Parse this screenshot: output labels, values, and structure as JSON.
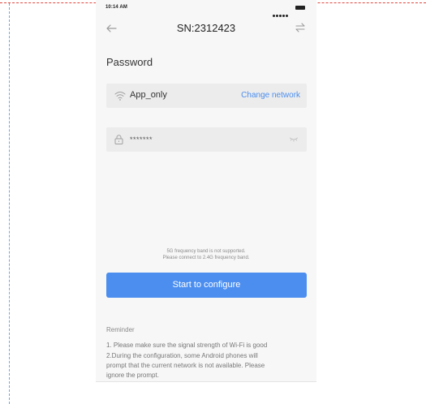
{
  "status_bar": {
    "time": "10:14 AM",
    "icons": [
      "signal-dots-icon",
      "battery-icon"
    ]
  },
  "header": {
    "back_icon": "arrow-left-icon",
    "title": "SN:2312423",
    "swap_icon": "swap-arrows-icon"
  },
  "form": {
    "section_title": "Password",
    "network": {
      "icon": "wifi-icon",
      "name": "App_only",
      "change_label": "Change network"
    },
    "password": {
      "icon": "lock-icon",
      "value": "*******",
      "toggle_icon": "eye-closed-icon"
    }
  },
  "hint": {
    "line1": "5G frequency band is not supported.",
    "line2": "Please connect to 2.4G frequency band."
  },
  "actions": {
    "configure_label": "Start to configure"
  },
  "reminder": {
    "title": "Reminder",
    "lines": [
      "1. Please make sure the signal strength of Wi-Fi is good",
      "2.During the configuration, some Android phones will",
      "prompt that the current network is not available. Please",
      "ignore the prompt."
    ]
  },
  "colors": {
    "accent": "#4b8ef0",
    "field_bg": "#ececec",
    "page_bg": "#f7f7f7"
  }
}
